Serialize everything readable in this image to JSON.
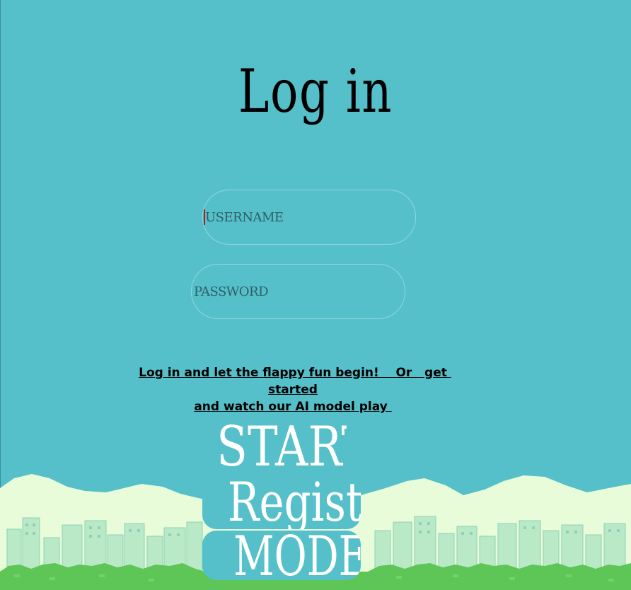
{
  "page": {
    "title": "Log in",
    "username": {
      "value": "",
      "placeholder": "USERNAME"
    },
    "password": {
      "value": "",
      "placeholder": "PASSWORD"
    },
    "tagline": "Log in and let the flappy fun begin!    Or   get started\nand watch our AI model play ",
    "buttons": {
      "start": "START",
      "register": "Register",
      "model": "MODEL"
    }
  },
  "colors": {
    "sky": "#55c0ca",
    "clouds": "#e9fcd9",
    "buildings": "#b9e9c6",
    "bushes": "#5ec656",
    "title_text": "#000000",
    "button_text": "#ffffff"
  }
}
